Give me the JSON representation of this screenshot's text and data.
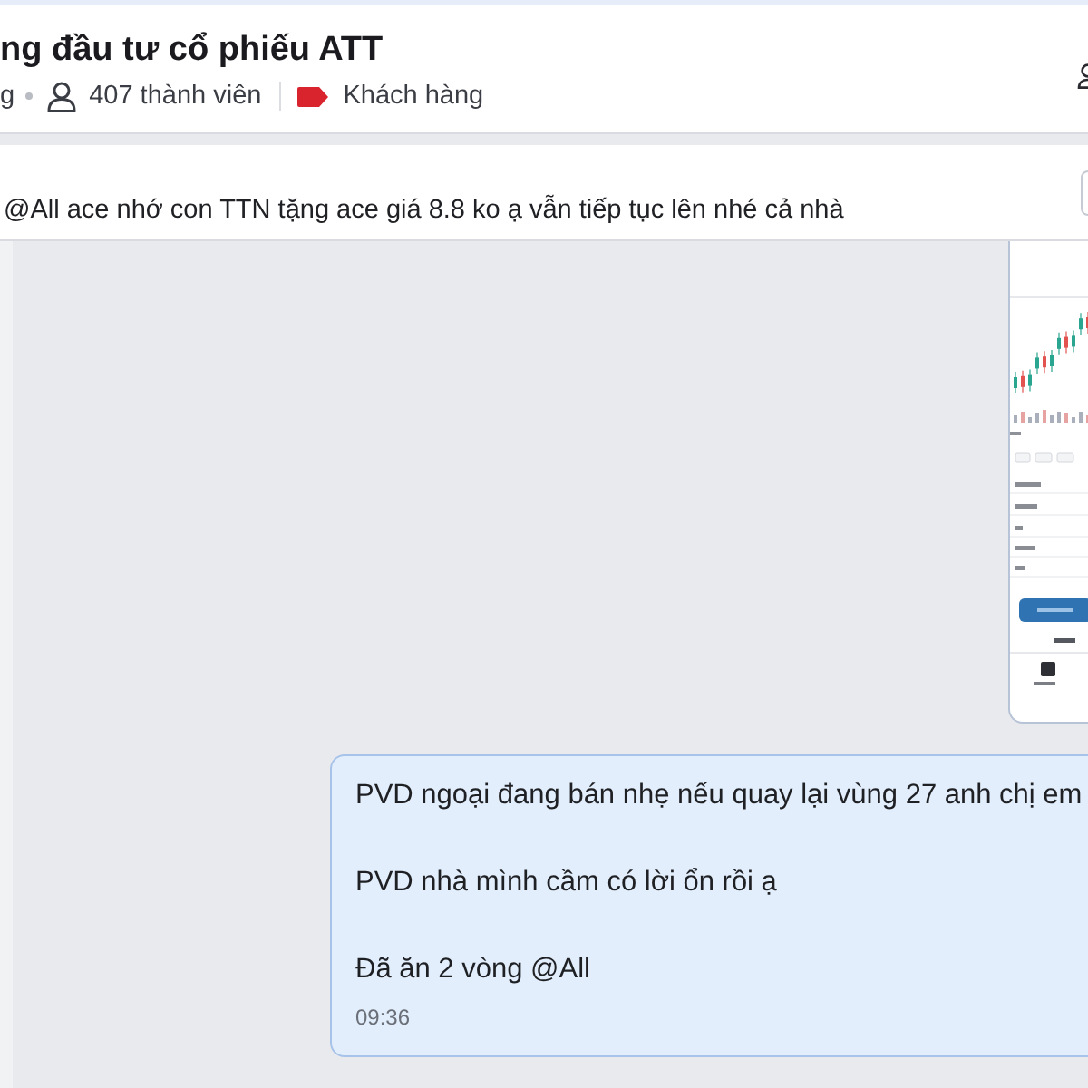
{
  "header": {
    "title": "ng đầu tư cổ phiếu ATT",
    "meta_prefix": "g",
    "member_count": "407 thành viên",
    "tag": "Khách hàng"
  },
  "pinned_message": {
    "text": "@All ace nhớ con TTN tặng ace giá 8.8 ko ạ vẫn tiếp tục lên nhé cả nhà"
  },
  "messages": [
    {
      "kind": "image"
    },
    {
      "kind": "text",
      "paragraphs": [
        "PVD ngoại đang bán nhẹ nếu quay lại vùng 27 anh chị em",
        "PVD nhà mình cầm có lời ổn rồi ạ",
        "Đã ăn 2 vòng @All"
      ],
      "time": "09:36"
    }
  ]
}
